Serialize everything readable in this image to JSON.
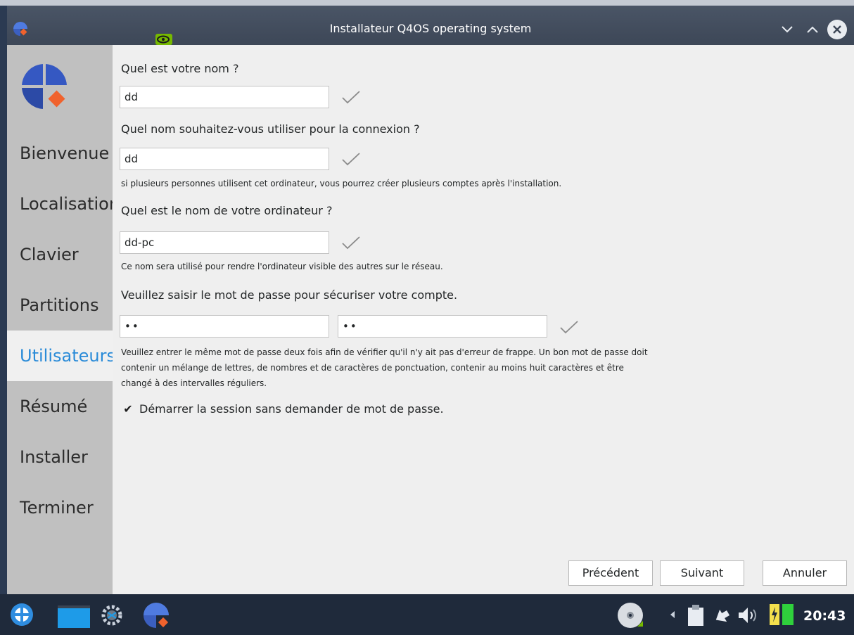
{
  "window": {
    "title": "Installateur Q4OS operating system"
  },
  "sidebar": {
    "items": [
      {
        "label": "Bienvenue"
      },
      {
        "label": "Localisation"
      },
      {
        "label": "Clavier"
      },
      {
        "label": "Partitions"
      },
      {
        "label": "Utilisateurs",
        "active": true
      },
      {
        "label": "Résumé"
      },
      {
        "label": "Installer"
      },
      {
        "label": "Terminer"
      }
    ]
  },
  "form": {
    "name_question": "Quel est votre nom ?",
    "name_value": "dd",
    "login_question": "Quel nom souhaitez-vous utiliser pour la connexion ?",
    "login_value": "dd",
    "login_hint": "si plusieurs personnes utilisent cet ordinateur, vous pourrez créer plusieurs comptes après l'installation.",
    "computer_question": "Quel est le nom de votre ordinateur ?",
    "computer_value": "dd-pc",
    "computer_hint": "Ce nom sera utilisé pour rendre l'ordinateur visible des autres sur le réseau.",
    "password_question": "Veuillez saisir le mot de passe pour sécuriser votre compte.",
    "password_value": "••",
    "password_confirm_value": "••",
    "password_hint_line1": "Veuillez entrer le même mot de passe deux fois afin de vérifier qu'il n'y ait pas d'erreur de frappe. Un bon mot de passe doit",
    "password_hint_line2": "contenir un mélange de lettres, de nombres et de caractères de ponctuation, contenir au moins huit caractères et être",
    "password_hint_line3": "changé à des intervalles réguliers.",
    "autologin_label": "Démarrer la session sans demander de mot de passe.",
    "autologin_checked": true,
    "checkmark": "✔"
  },
  "buttons": {
    "prev": "Précédent",
    "next": "Suivant",
    "cancel": "Annuler"
  },
  "taskbar": {
    "clock": "20:43"
  },
  "colors": {
    "accent": "#2a8bd8",
    "logo_blue": "#2f4fa8",
    "logo_orange": "#f0622d",
    "taskbar": "#1f2a3b"
  }
}
